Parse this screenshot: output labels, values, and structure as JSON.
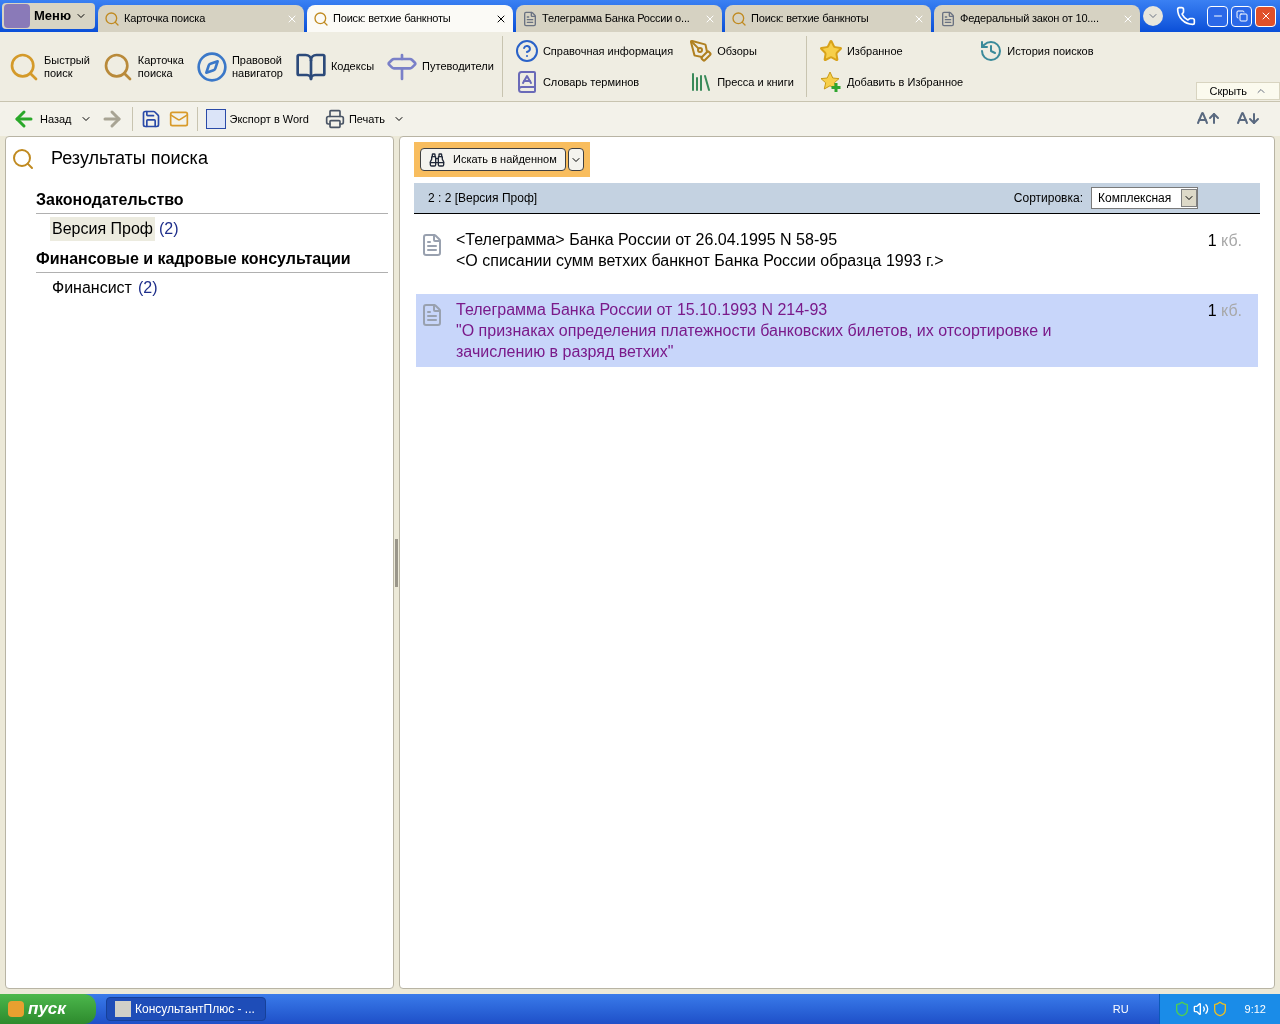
{
  "menu_button": {
    "label": "Меню"
  },
  "tabs": [
    {
      "label": "Карточка поиска",
      "kind": "search",
      "selected": false
    },
    {
      "label": "Поиск: ветхие банкноты",
      "kind": "search",
      "selected": true
    },
    {
      "label": "Телеграмма Банка России о...",
      "kind": "document",
      "selected": false
    },
    {
      "label": "Поиск: ветхие банкноты",
      "kind": "search",
      "selected": false
    },
    {
      "label": "Федеральный закон от 10....",
      "kind": "document",
      "selected": false
    }
  ],
  "ribbon": {
    "large_items": [
      {
        "label": "Быстрый поиск",
        "kind": "quick_search"
      },
      {
        "label": "Карточка поиска",
        "kind": "search_card"
      },
      {
        "label": "Правовой навигатор",
        "kind": "navigator"
      },
      {
        "label": "Кодексы",
        "kind": "codes"
      },
      {
        "label": "Путеводители",
        "kind": "guides"
      }
    ],
    "groups": [
      [
        {
          "label": "Справочная информация",
          "kind": "reference"
        },
        {
          "label": "Словарь терминов",
          "kind": "dictionary"
        },
        {
          "label": "Обзоры",
          "kind": "reviews"
        },
        {
          "label": "Пресса и книги",
          "kind": "press"
        }
      ],
      [
        {
          "label": "Избранное",
          "kind": "favorites"
        },
        {
          "label": "Добавить в Избранное",
          "kind": "add_favorite"
        },
        {
          "label": "История поисков",
          "kind": "history"
        }
      ]
    ],
    "hide_button": "Скрыть"
  },
  "toolbar": {
    "back": "Назад",
    "export": "Экспорт в Word",
    "print": "Печать"
  },
  "left_panel": {
    "title": "Результаты поиска",
    "sections": [
      {
        "title": "Законодательство",
        "items": [
          {
            "label": "Версия Проф",
            "count": "(2)",
            "selected": true
          }
        ]
      },
      {
        "title": "Финансовые и кадровые консультации",
        "items": [
          {
            "label": "Финансист",
            "count": "(2)",
            "selected": false
          }
        ]
      }
    ]
  },
  "right_panel": {
    "search_in_results": "Искать в найденном",
    "status": "2 : 2 [Версия Проф]",
    "sort_label": "Сортировка:",
    "sort_value": "Комплексная",
    "results": [
      {
        "title": "<Телеграмма> Банка России от 26.04.1995 N 58-95",
        "subtitle": "<О списании сумм ветхих банкнот Банка России образца 1993 г.>",
        "size": "1",
        "unit": "кб.",
        "selected": false,
        "visited": false
      },
      {
        "title": "Телеграмма Банка России от 15.10.1993 N 214-93",
        "subtitle": "\"О признаках определения платежности банковских билетов, их отсортировке и зачислению в разряд ветхих\"",
        "size": "1",
        "unit": "кб.",
        "selected": true,
        "visited": true
      }
    ]
  },
  "taskbar": {
    "start": "пуск",
    "task": "КонсультантПлюс - ...",
    "language": "RU",
    "time": "9:12"
  }
}
